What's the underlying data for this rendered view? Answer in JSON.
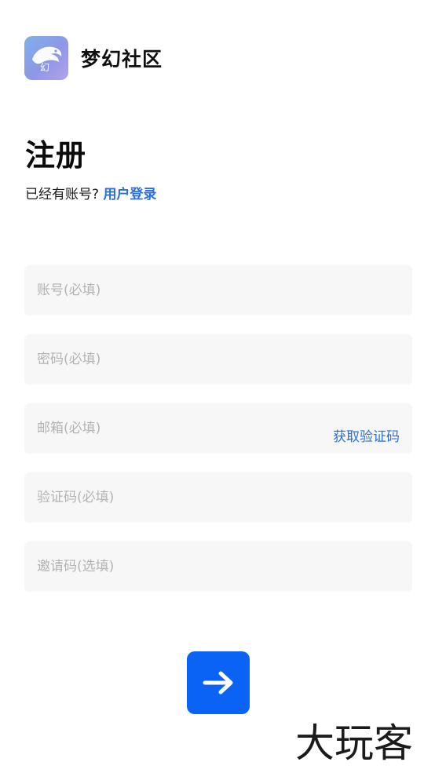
{
  "app": {
    "name": "梦幻社区",
    "icon": "dolphin-logo-icon",
    "icon_glyph": "幻"
  },
  "register": {
    "title": "注册",
    "has_account_text": "已经有账号?",
    "login_link": "用户登录"
  },
  "form": {
    "account_placeholder": "账号(必填)",
    "password_placeholder": "密码(必填)",
    "email_placeholder": "邮箱(必填)",
    "get_code_label": "获取验证码",
    "code_placeholder": "验证码(必填)",
    "invite_placeholder": "邀请码(选填)"
  },
  "submit": {
    "icon": "arrow-right-icon"
  },
  "watermark": {
    "text": "大玩客"
  },
  "colors": {
    "accent": "#0a63f5",
    "link": "#2a6fdb",
    "field_bg": "#f7f7f7",
    "placeholder": "#b3b3b3"
  }
}
